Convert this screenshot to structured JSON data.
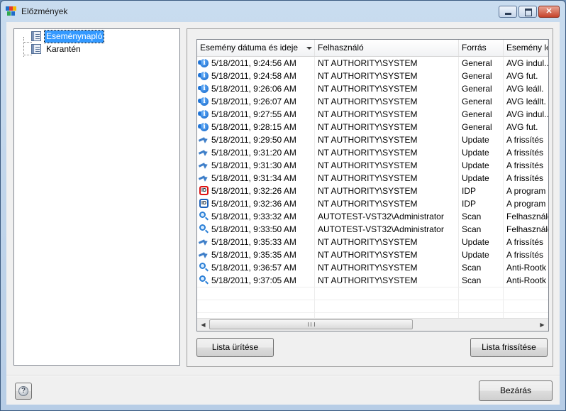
{
  "window": {
    "title": "Előzmények",
    "logo_colors": [
      "#1e6cc8",
      "#e23b2e",
      "#f5b800",
      "#2fa84f"
    ]
  },
  "tree": {
    "items": [
      {
        "label": "Eseménynapló",
        "icon": "log-book-icon",
        "selected": true
      },
      {
        "label": "Karantén",
        "icon": "quarantine-book-icon",
        "selected": false
      }
    ]
  },
  "list": {
    "columns": [
      {
        "label": "Esemény dátuma és ideje",
        "sorted": "descending"
      },
      {
        "label": "Felhasználó"
      },
      {
        "label": "Forrás"
      },
      {
        "label": "Esemény le"
      }
    ],
    "rows": [
      {
        "icon": "info",
        "datetime": "5/18/2011, 9:24:56 AM",
        "user": "NT AUTHORITY\\SYSTEM",
        "source": "General",
        "event": "AVG indul..."
      },
      {
        "icon": "info",
        "datetime": "5/18/2011, 9:24:58 AM",
        "user": "NT AUTHORITY\\SYSTEM",
        "source": "General",
        "event": "AVG fut."
      },
      {
        "icon": "info",
        "datetime": "5/18/2011, 9:26:06 AM",
        "user": "NT AUTHORITY\\SYSTEM",
        "source": "General",
        "event": "AVG leáll."
      },
      {
        "icon": "info",
        "datetime": "5/18/2011, 9:26:07 AM",
        "user": "NT AUTHORITY\\SYSTEM",
        "source": "General",
        "event": "AVG leállt."
      },
      {
        "icon": "info",
        "datetime": "5/18/2011, 9:27:55 AM",
        "user": "NT AUTHORITY\\SYSTEM",
        "source": "General",
        "event": "AVG indul..."
      },
      {
        "icon": "info",
        "datetime": "5/18/2011, 9:28:15 AM",
        "user": "NT AUTHORITY\\SYSTEM",
        "source": "General",
        "event": "AVG fut."
      },
      {
        "icon": "update",
        "datetime": "5/18/2011, 9:29:50 AM",
        "user": "NT AUTHORITY\\SYSTEM",
        "source": "Update",
        "event": "A frissítés"
      },
      {
        "icon": "update",
        "datetime": "5/18/2011, 9:31:20 AM",
        "user": "NT AUTHORITY\\SYSTEM",
        "source": "Update",
        "event": "A frissítés"
      },
      {
        "icon": "update",
        "datetime": "5/18/2011, 9:31:30 AM",
        "user": "NT AUTHORITY\\SYSTEM",
        "source": "Update",
        "event": "A frissítés"
      },
      {
        "icon": "update",
        "datetime": "5/18/2011, 9:31:34 AM",
        "user": "NT AUTHORITY\\SYSTEM",
        "source": "Update",
        "event": "A frissítés"
      },
      {
        "icon": "idp-red",
        "datetime": "5/18/2011, 9:32:26 AM",
        "user": "NT AUTHORITY\\SYSTEM",
        "source": "IDP",
        "event": "A program"
      },
      {
        "icon": "idp-blue",
        "datetime": "5/18/2011, 9:32:36 AM",
        "user": "NT AUTHORITY\\SYSTEM",
        "source": "IDP",
        "event": "A program"
      },
      {
        "icon": "scan",
        "datetime": "5/18/2011, 9:33:32 AM",
        "user": "AUTOTEST-VST32\\Administrator",
        "source": "Scan",
        "event": "Felhasználó"
      },
      {
        "icon": "scan",
        "datetime": "5/18/2011, 9:33:50 AM",
        "user": "AUTOTEST-VST32\\Administrator",
        "source": "Scan",
        "event": "Felhasználó"
      },
      {
        "icon": "update",
        "datetime": "5/18/2011, 9:35:33 AM",
        "user": "NT AUTHORITY\\SYSTEM",
        "source": "Update",
        "event": "A frissítés"
      },
      {
        "icon": "update",
        "datetime": "5/18/2011, 9:35:35 AM",
        "user": "NT AUTHORITY\\SYSTEM",
        "source": "Update",
        "event": "A frissítés"
      },
      {
        "icon": "scan",
        "datetime": "5/18/2011, 9:36:57 AM",
        "user": "NT AUTHORITY\\SYSTEM",
        "source": "Scan",
        "event": "Anti-Rootk"
      },
      {
        "icon": "scan",
        "datetime": "5/18/2011, 9:37:05 AM",
        "user": "NT AUTHORITY\\SYSTEM",
        "source": "Scan",
        "event": "Anti-Rootk"
      }
    ],
    "idp_icon_text": "ID"
  },
  "buttons": {
    "clear_list": "Lista ürítése",
    "refresh_list": "Lista frissítése",
    "close": "Bezárás"
  },
  "help_icon_text": "?"
}
